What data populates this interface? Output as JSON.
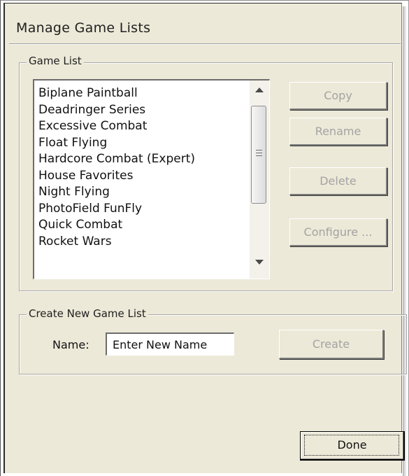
{
  "window": {
    "title": "Manage Game Lists"
  },
  "game_list_group": {
    "legend": "Game List",
    "items": [
      "Biplane Paintball",
      "Deadringer Series",
      "Excessive Combat",
      "Float Flying",
      "Hardcore Combat (Expert)",
      "House Favorites",
      "Night Flying",
      "PhotoField FunFly",
      "Quick Combat",
      "Rocket Wars"
    ],
    "buttons": {
      "copy": "Copy",
      "rename": "Rename",
      "delete": "Delete",
      "configure": "Configure ..."
    }
  },
  "create_group": {
    "legend": "Create New Game List",
    "name_label": "Name:",
    "name_value": "Enter New Name",
    "create_button": "Create"
  },
  "footer": {
    "done_button": "Done"
  },
  "icons": {
    "scroll_up": "scroll-up-arrow-icon",
    "scroll_down": "scroll-down-arrow-icon",
    "scroll_grip": "scroll-grip-icon"
  },
  "colors": {
    "dialog_background": "#ece9d8",
    "disabled_text": "#a3a3a3"
  }
}
